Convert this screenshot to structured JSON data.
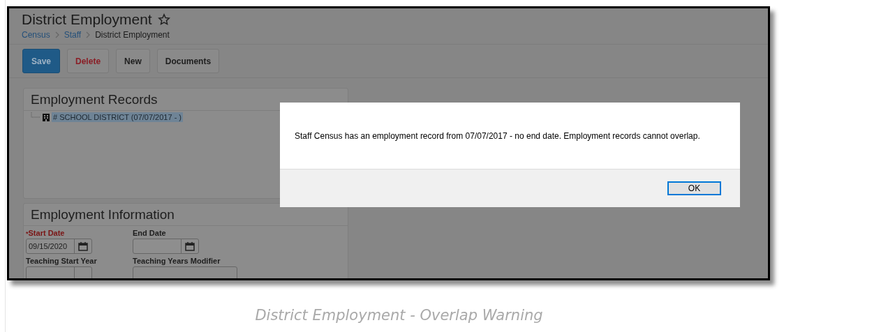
{
  "page": {
    "title": "District Employment",
    "breadcrumbs": [
      {
        "label": "Census",
        "kind": "link"
      },
      {
        "label": "Staff",
        "kind": "link"
      },
      {
        "label": "District Employment",
        "kind": "current"
      }
    ]
  },
  "toolbar": [
    {
      "label": "Save",
      "kind": "primary"
    },
    {
      "label": "Delete",
      "kind": "danger"
    },
    {
      "label": "New",
      "kind": "default"
    },
    {
      "label": "Documents",
      "kind": "default"
    }
  ],
  "employment_records": {
    "title": "Employment Records",
    "items": [
      {
        "label": "# SCHOOL DISTRICT (07/07/2017 - )",
        "selected": true
      }
    ]
  },
  "employment_information": {
    "title": "Employment Information",
    "required_marker": "*",
    "fields": [
      {
        "label": "Start Date",
        "required": true,
        "value": "09/15/2020",
        "kind": "date"
      },
      {
        "label": "End Date",
        "required": false,
        "kind": "date"
      },
      {
        "label": "Teaching Start Year",
        "required": false,
        "kind": "spinner"
      },
      {
        "label": "Teaching Years Modifier",
        "required": false,
        "kind": "text"
      }
    ]
  },
  "dialog": {
    "message": "Staff Census has an employment record from 07/07/2017 - no end date. Employment records cannot overlap.",
    "buttons": [
      "OK"
    ]
  },
  "caption": "District Employment - Overlap Warning"
}
